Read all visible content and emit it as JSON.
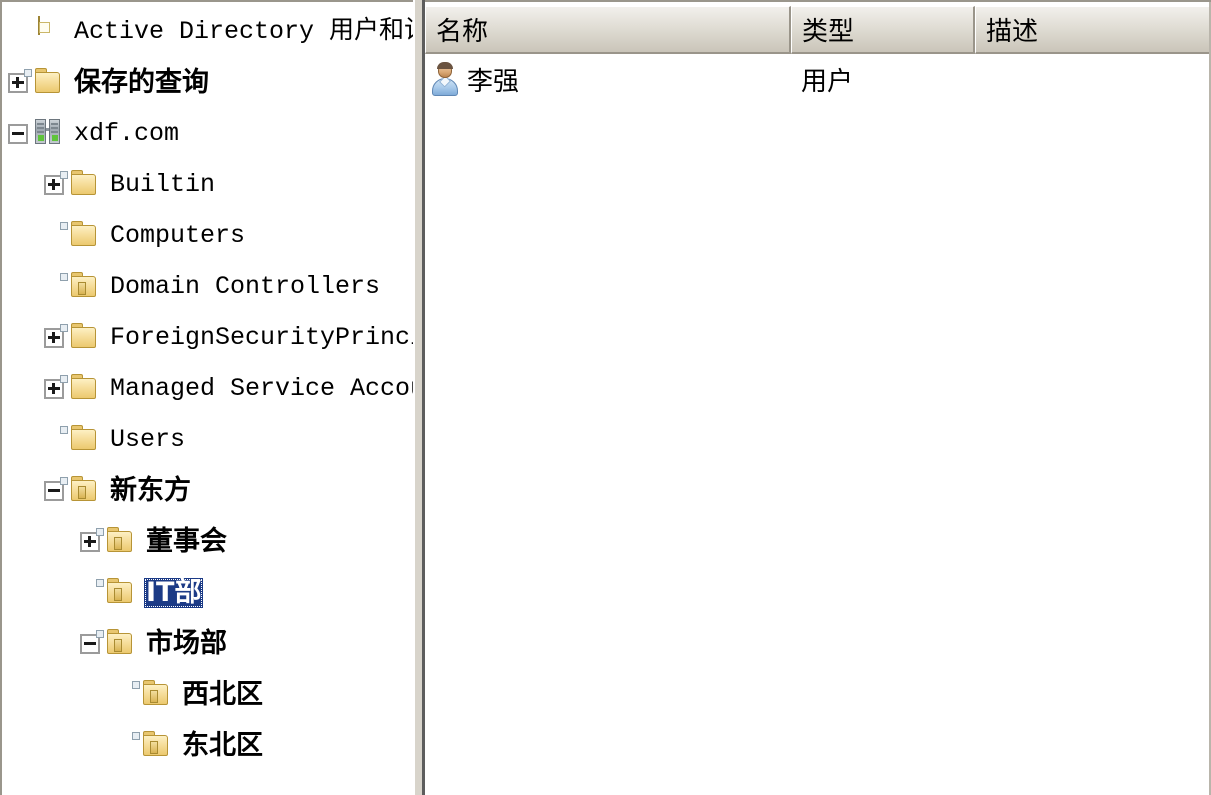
{
  "window": {
    "title": "Active Directory 用户和计算机"
  },
  "tree": {
    "name": "console-tree",
    "selected_node": "IT部",
    "selection_color": "#1b3a86",
    "nodes": [
      {
        "label": "Active Directory 用户和计算机 [W",
        "icon": "console-root-icon",
        "depth": 0,
        "twisty": "none",
        "script": "latin",
        "selected": false
      },
      {
        "label": "保存的查询",
        "icon": "folder-icon",
        "depth": 0,
        "twisty": "plus",
        "script": "cjk",
        "selected": false
      },
      {
        "label": "xdf.com",
        "icon": "domain-icon",
        "depth": 0,
        "twisty": "minus",
        "script": "latin",
        "selected": false
      },
      {
        "label": "Builtin",
        "icon": "folder-icon",
        "depth": 1,
        "twisty": "plus",
        "script": "latin",
        "selected": false
      },
      {
        "label": "Computers",
        "icon": "folder-icon",
        "depth": 1,
        "twisty": "none",
        "script": "latin",
        "selected": false
      },
      {
        "label": "Domain Controllers",
        "icon": "ou-folder-icon",
        "depth": 1,
        "twisty": "none",
        "script": "latin",
        "selected": false
      },
      {
        "label": "ForeignSecurityPrincipals",
        "icon": "folder-icon",
        "depth": 1,
        "twisty": "plus",
        "script": "latin",
        "selected": false
      },
      {
        "label": "Managed Service Accounts",
        "icon": "folder-icon",
        "depth": 1,
        "twisty": "plus",
        "script": "latin",
        "selected": false
      },
      {
        "label": "Users",
        "icon": "folder-icon",
        "depth": 1,
        "twisty": "none",
        "script": "latin",
        "selected": false
      },
      {
        "label": "新东方",
        "icon": "ou-folder-icon",
        "depth": 1,
        "twisty": "minus",
        "script": "cjk",
        "selected": false
      },
      {
        "label": "董事会",
        "icon": "ou-folder-icon",
        "depth": 2,
        "twisty": "plus",
        "script": "cjk",
        "selected": false
      },
      {
        "label": "IT部",
        "icon": "ou-folder-icon",
        "depth": 2,
        "twisty": "none",
        "script": "cjk",
        "selected": true
      },
      {
        "label": "市场部",
        "icon": "ou-folder-icon",
        "depth": 2,
        "twisty": "minus",
        "script": "cjk",
        "selected": false
      },
      {
        "label": "西北区",
        "icon": "ou-folder-icon",
        "depth": 3,
        "twisty": "none",
        "script": "cjk",
        "selected": false
      },
      {
        "label": "东北区",
        "icon": "ou-folder-icon",
        "depth": 3,
        "twisty": "none",
        "script": "cjk",
        "selected": false
      }
    ]
  },
  "list": {
    "columns": [
      {
        "label": "名称",
        "key": "name"
      },
      {
        "label": "类型",
        "key": "type"
      },
      {
        "label": "描述",
        "key": "description"
      }
    ],
    "rows": [
      {
        "name": "李强",
        "type": "用户",
        "description": "",
        "icon": "user-icon"
      }
    ]
  }
}
